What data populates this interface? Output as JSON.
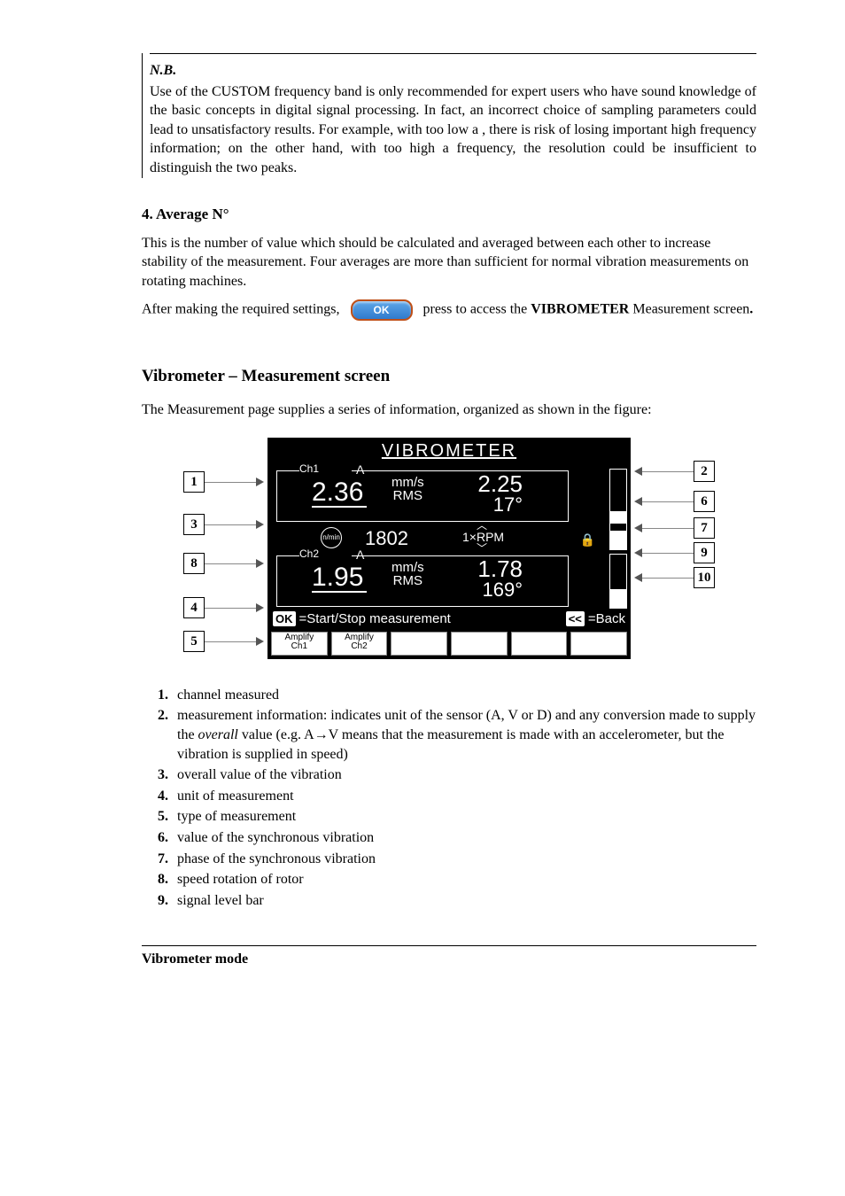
{
  "nb": {
    "title": "N.B.",
    "body": "Use of the CUSTOM frequency band is only recommended for expert users who have sound knowledge of the basic concepts in digital signal processing. In fact, an incorrect choice of sampling parameters could lead to unsatisfactory results. For example, with too low a      ,   there is risk of losing important high frequency information; on the other hand, with too high a frequency, the resolution could be insufficient to distinguish the two peaks."
  },
  "section4": {
    "heading": "4.  Average N°",
    "body": "This is the number of value which should be calculated and averaged between each other to increase stability of the measurement. Four averages are more than sufficient for normal vibration measurements on rotating machines.",
    "after_settings_pre": "After making the required settings, ",
    "ok_label": "OK",
    "after_settings_post": " press  to access the ",
    "bold_target": "VIBROMETER",
    "after_settings_tail": " Measurement screen",
    "period": "."
  },
  "section_screen": {
    "heading": "Vibrometer – Measurement screen",
    "intro": "The Measurement page supplies a series of information, organized as shown in the figure:"
  },
  "device": {
    "title": "VIBROMETER",
    "ch1": {
      "label": "Ch1",
      "conv": "A",
      "overall": "2.36",
      "unit": "mm/s",
      "type": "RMS",
      "sync_val": "2.25",
      "sync_phase": "17°",
      "level_pct": 20
    },
    "rpm": {
      "value": "1802",
      "mult": "1×RPM"
    },
    "ch2": {
      "label": "Ch2",
      "conv": "A",
      "overall": "1.95",
      "unit": "mm/s",
      "type": "RMS",
      "sync_val": "1.78",
      "sync_phase": "169°",
      "level_pct": 35
    },
    "help": {
      "ok_key": "OK",
      "ok_text": "=Start/Stop measurement",
      "back_key": "<<",
      "back_text": "=Back"
    },
    "softkeys": [
      "Amplify\nCh1",
      "Amplify\nCh2",
      "",
      "",
      "",
      ""
    ]
  },
  "callouts": {
    "1": "1",
    "2": "2",
    "3": "3",
    "4": "4",
    "5": "5",
    "6": "6",
    "7": "7",
    "8": "8",
    "9": "9",
    "10": "10"
  },
  "legend": {
    "1": "channel measured",
    "2_pre": "measurement information: indicates unit of the sensor (A, V or D) and any conversion made to supply the ",
    "2_ital": "overall",
    "2_mid": " value (e.g. A",
    "2_arrow": "→",
    "2_post": "V means that the measurement is made with an accelerometer, but the vibration is supplied in speed)",
    "3": "overall value of the vibration",
    "4": "unit of measurement",
    "5": "type of measurement",
    "6": "value of the synchronous vibration",
    "7": "phase of the synchronous vibration",
    "8": "speed rotation of rotor",
    "9": " signal level bar"
  },
  "footer": "Vibrometer mode"
}
